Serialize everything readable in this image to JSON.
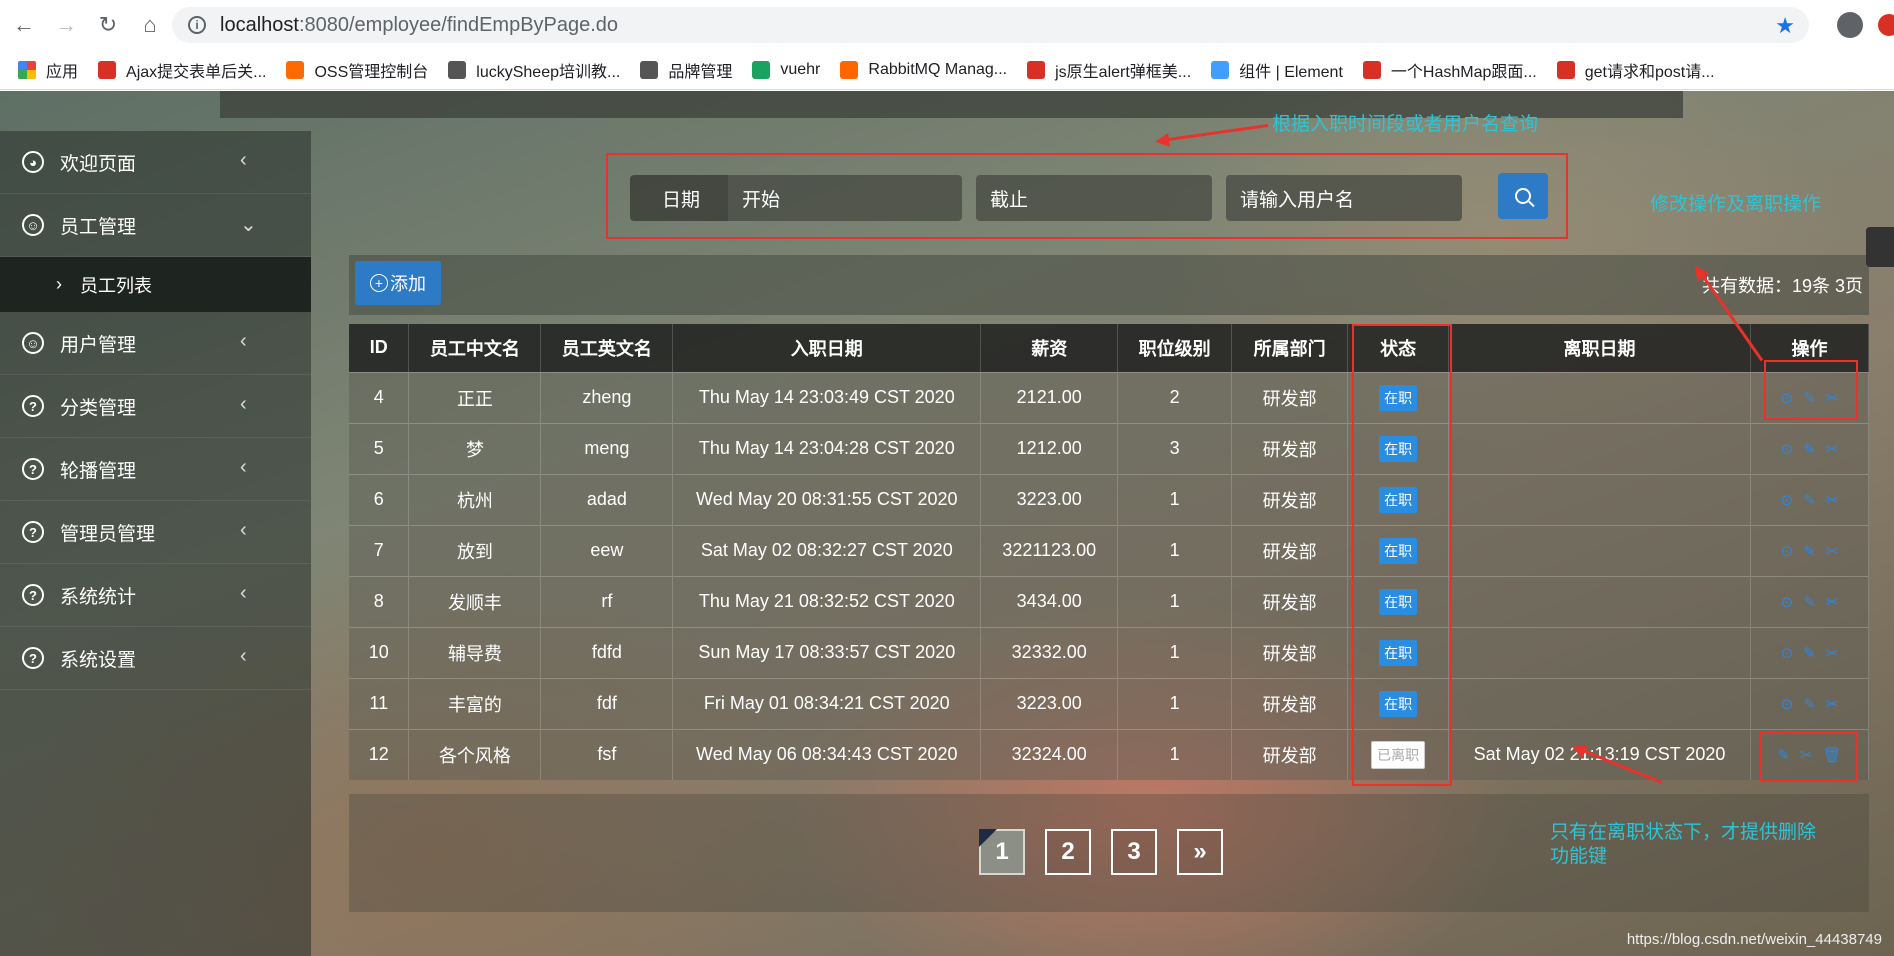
{
  "browser": {
    "url_host": "localhost",
    "url_rest": ":8080/employee/findEmpByPage.do",
    "bookmarks": [
      {
        "label": "应用",
        "color": "#4285f4"
      },
      {
        "label": "Ajax提交表单后关...",
        "color": "#d93025"
      },
      {
        "label": "OSS管理控制台",
        "color": "#ff6a00"
      },
      {
        "label": "luckySheep培训教...",
        "color": "#555555"
      },
      {
        "label": "品牌管理",
        "color": "#555555"
      },
      {
        "label": "vuehr",
        "color": "#1aa260"
      },
      {
        "label": "RabbitMQ Manag...",
        "color": "#ff6600"
      },
      {
        "label": "js原生alert弹框美...",
        "color": "#d93025"
      },
      {
        "label": "组件 | Element",
        "color": "#409eff"
      },
      {
        "label": "一个HashMap跟面...",
        "color": "#d93025"
      },
      {
        "label": "get请求和post请...",
        "color": "#d93025"
      }
    ]
  },
  "sidebar": {
    "items": [
      {
        "label": "欢迎页面",
        "icon": "palette-icon",
        "arrow": "‹"
      },
      {
        "label": "员工管理",
        "icon": "user-circle-icon",
        "arrow": "⌄"
      },
      {
        "label": "用户管理",
        "icon": "user-circle-icon",
        "arrow": "‹"
      },
      {
        "label": "分类管理",
        "icon": "question-icon",
        "arrow": "‹"
      },
      {
        "label": "轮播管理",
        "icon": "question-icon",
        "arrow": "‹"
      },
      {
        "label": "管理员管理",
        "icon": "question-icon",
        "arrow": "‹"
      },
      {
        "label": "系统统计",
        "icon": "question-icon",
        "arrow": "‹"
      },
      {
        "label": "系统设置",
        "icon": "question-icon",
        "arrow": "‹"
      }
    ],
    "sub_item": "员工列表"
  },
  "search": {
    "date_label": "日期",
    "start_placeholder": "开始",
    "end_placeholder": "截止",
    "user_placeholder": "请输入用户名"
  },
  "toolbar": {
    "add_label": "添加",
    "total_text": "共有数据：19条 3页"
  },
  "table": {
    "headers": [
      "ID",
      "员工中文名",
      "员工英文名",
      "入职日期",
      "薪资",
      "职位级别",
      "所属部门",
      "状态",
      "离职日期",
      "操作"
    ],
    "rows": [
      {
        "id": "4",
        "cn": "正正",
        "en": "zheng",
        "hire": "Thu May 14 23:03:49 CST 2020",
        "salary": "2121.00",
        "level": "2",
        "dept": "研发部",
        "status": "在职",
        "leave": ""
      },
      {
        "id": "5",
        "cn": "梦",
        "en": "meng",
        "hire": "Thu May 14 23:04:28 CST 2020",
        "salary": "1212.00",
        "level": "3",
        "dept": "研发部",
        "status": "在职",
        "leave": ""
      },
      {
        "id": "6",
        "cn": "杭州",
        "en": "adad",
        "hire": "Wed May 20 08:31:55 CST 2020",
        "salary": "3223.00",
        "level": "1",
        "dept": "研发部",
        "status": "在职",
        "leave": ""
      },
      {
        "id": "7",
        "cn": "放到",
        "en": "eew",
        "hire": "Sat May 02 08:32:27 CST 2020",
        "salary": "3221123.00",
        "level": "1",
        "dept": "研发部",
        "status": "在职",
        "leave": ""
      },
      {
        "id": "8",
        "cn": "发顺丰",
        "en": "rf",
        "hire": "Thu May 21 08:32:52 CST 2020",
        "salary": "3434.00",
        "level": "1",
        "dept": "研发部",
        "status": "在职",
        "leave": ""
      },
      {
        "id": "10",
        "cn": "辅导费",
        "en": "fdfd",
        "hire": "Sun May 17 08:33:57 CST 2020",
        "salary": "32332.00",
        "level": "1",
        "dept": "研发部",
        "status": "在职",
        "leave": ""
      },
      {
        "id": "11",
        "cn": "丰富的",
        "en": "fdf",
        "hire": "Fri May 01 08:34:21 CST 2020",
        "salary": "3223.00",
        "level": "1",
        "dept": "研发部",
        "status": "在职",
        "leave": ""
      },
      {
        "id": "12",
        "cn": "各个风格",
        "en": "fsf",
        "hire": "Wed May 06 08:34:43 CST 2020",
        "salary": "32324.00",
        "level": "1",
        "dept": "研发部",
        "status": "已离职",
        "leave": "Sat May 02 21:13:19 CST 2020"
      }
    ]
  },
  "pagination": {
    "pages": [
      "1",
      "2",
      "3"
    ],
    "next": "»",
    "current": "1"
  },
  "annotations": {
    "search_note": "根据入职时间段或者用户名查询",
    "ops_note": "修改操作及离职操作",
    "delete_note_line1": "只有在离职状态下，才提供删除",
    "delete_note_line2": "功能键"
  },
  "watermark": "https://blog.csdn.net/weixin_44438749"
}
